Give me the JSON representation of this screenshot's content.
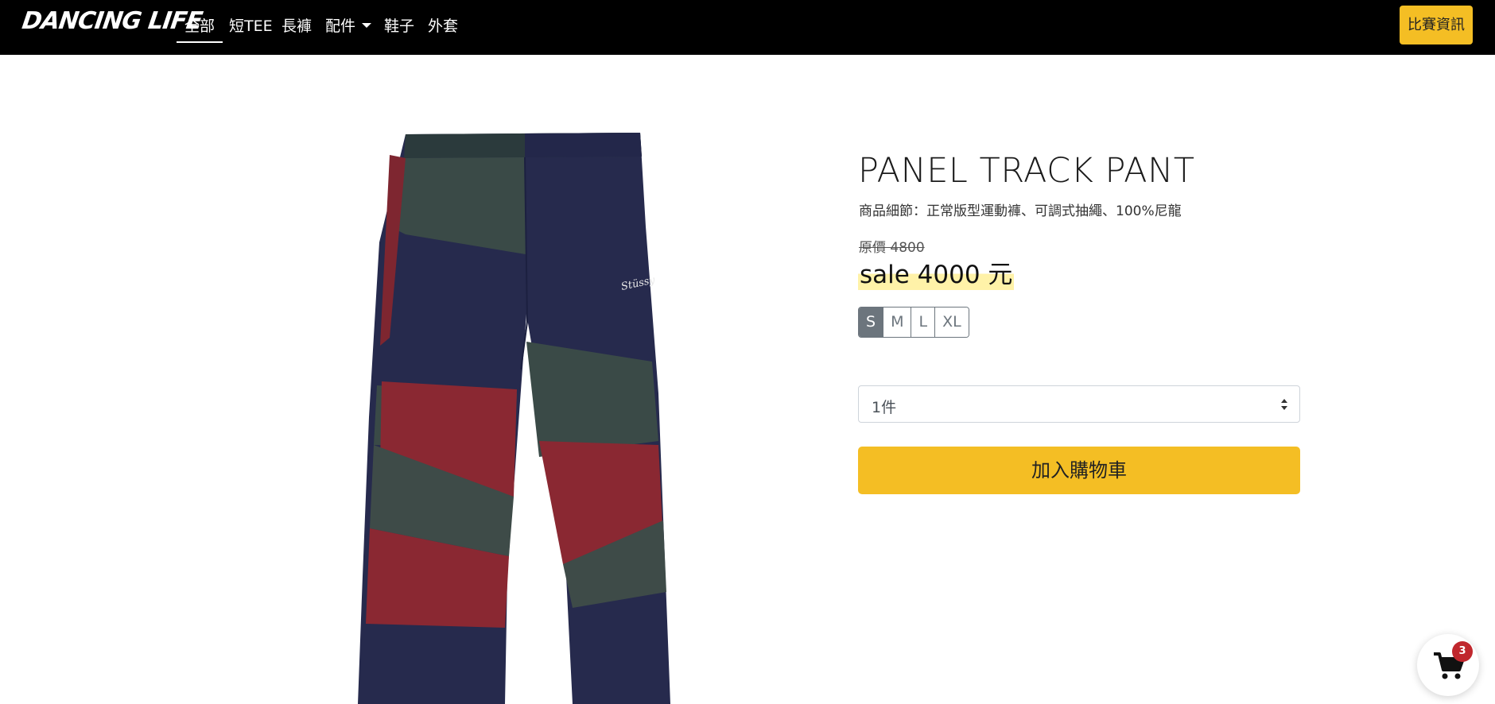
{
  "navbar": {
    "brand": "DANCING LIFE",
    "items": [
      {
        "label": "全部"
      },
      {
        "label": "短TEE"
      },
      {
        "label": "長褲"
      },
      {
        "label": "配件"
      },
      {
        "label": "鞋子"
      },
      {
        "label": "外套"
      }
    ],
    "contest_button": "比賽資訊"
  },
  "product": {
    "title": "PANEL TRACK PANT",
    "details": "商品細節：正常版型運動褲、可調式抽繩、100%尼龍",
    "original_price": "原價 4800",
    "sale_price": "sale 4000 元",
    "sizes": [
      "S",
      "M",
      "L",
      "XL"
    ],
    "selected_size": "S",
    "quantity": "1件",
    "add_to_cart": "加入購物車",
    "image_logo_text": "Stüssy"
  },
  "cart": {
    "count": "3"
  },
  "colors": {
    "accent": "#f4be24",
    "navbar_bg": "#000000",
    "badge": "#c0272d",
    "size_selected": "#6c757d",
    "pant_navy": "#262a4d",
    "pant_green": "#3a4a47",
    "pant_red": "#8a2832"
  }
}
